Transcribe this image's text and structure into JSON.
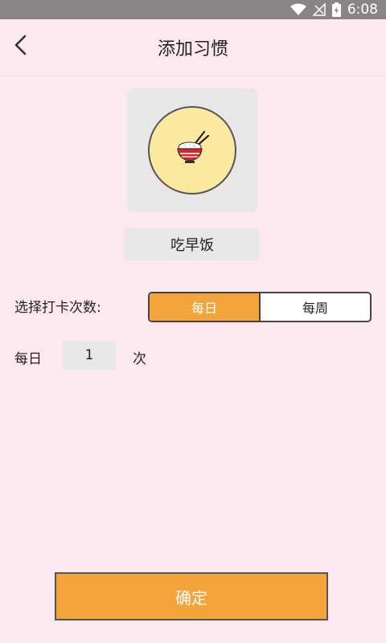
{
  "status_bar": {
    "time": "6:08",
    "icons": [
      "wifi-icon",
      "signal-icon",
      "battery-charging-icon"
    ]
  },
  "app_bar": {
    "title": "添加习惯",
    "back_icon": "back-arrow-icon"
  },
  "habit": {
    "icon": "rice-bowl-icon",
    "name": "吃早饭"
  },
  "frequency": {
    "label": "选择打卡次数:",
    "options": [
      "每日",
      "每周"
    ],
    "selected": "每日"
  },
  "count": {
    "prefix": "每日",
    "value": "1",
    "suffix": "次"
  },
  "confirm_label": "确定",
  "colors": {
    "background": "#fce8ef",
    "accent": "#f3a53b",
    "tile": "#e8e6e7",
    "icon_circle": "#fbe9a0"
  }
}
